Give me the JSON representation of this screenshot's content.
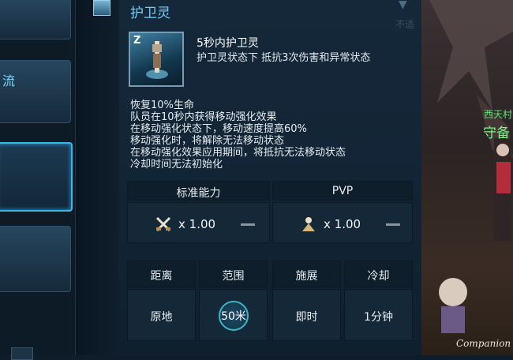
{
  "left_panel": {
    "items": [
      {
        "label": ""
      },
      {
        "label": "流"
      },
      {
        "label": ""
      },
      {
        "label": ""
      }
    ]
  },
  "skill": {
    "panel_title": "护卫灵",
    "faded_label": "不适",
    "icon_key": "Z",
    "name": "5秒内护卫灵",
    "subtitle": "护卫灵状态下 抵抗3次伤害和异常状态",
    "description": [
      "恢复10%生命",
      "队员在10秒内获得移动强化效果",
      "在移动强化状态下，移动速度提高60%",
      "移动强化时，将解除无法移动状态",
      "在移动强化效果应用期间，将抵抗无法移动状态",
      "冷却时间无法初始化"
    ]
  },
  "stats": {
    "headers": [
      "标准能力",
      "PVP"
    ],
    "standard": {
      "icon": "crossed-swords-icon",
      "value": "x 1.00"
    },
    "pvp": {
      "icon": "pvp-figure-icon",
      "value": "x 1.00"
    }
  },
  "attributes": {
    "headers": [
      "距离",
      "范围",
      "施展",
      "冷却"
    ],
    "values": [
      "原地",
      "50米",
      "即时",
      "1分钟"
    ]
  },
  "scene": {
    "npc_title": "西天村",
    "npc_name": "守备",
    "watermark": "Companion"
  },
  "colors": {
    "accent": "#38b6e8",
    "title": "#6fd0ff",
    "npc": "#5fe37a"
  }
}
